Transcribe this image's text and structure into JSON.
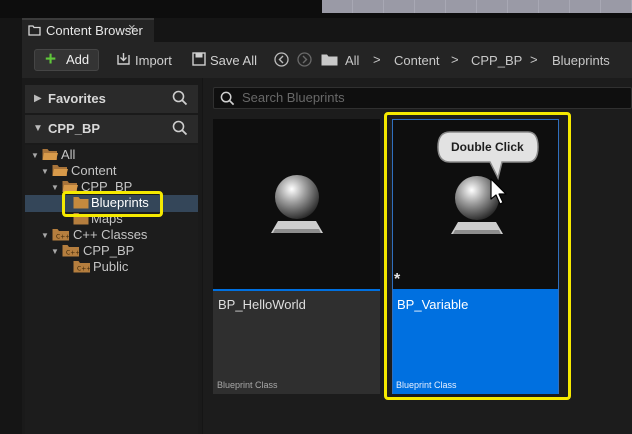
{
  "tab": {
    "title": "Content Browser",
    "close_glyph": "×"
  },
  "toolbar": {
    "add_label": "Add",
    "import_label": "Import",
    "save_all_label": "Save All",
    "breadcrumbs": [
      "All",
      "Content",
      "CPP_BP",
      "Blueprints"
    ],
    "breadcrumb_separator": ">"
  },
  "sidebar": {
    "favorites_label": "Favorites",
    "project_label": "CPP_BP",
    "tree": [
      {
        "label": "All"
      },
      {
        "label": "Content"
      },
      {
        "label": "CPP_BP"
      },
      {
        "label": "Blueprints",
        "selected": true
      },
      {
        "label": "Maps"
      },
      {
        "label": "C++ Classes"
      },
      {
        "label": "CPP_BP"
      },
      {
        "label": "Public"
      }
    ]
  },
  "search": {
    "placeholder": "Search Blueprints"
  },
  "assets": [
    {
      "name": "BP_HelloWorld",
      "type": "Blueprint Class"
    },
    {
      "name": "BP_Variable",
      "type": "Blueprint Class",
      "selected": true,
      "modified_marker": "*"
    }
  ],
  "callout": {
    "text": "Double Click"
  },
  "colors": {
    "accent_blue": "#0070e0",
    "highlight_yellow": "#f5e900",
    "add_green": "#5fc73a",
    "folder": "#c58a3e"
  }
}
